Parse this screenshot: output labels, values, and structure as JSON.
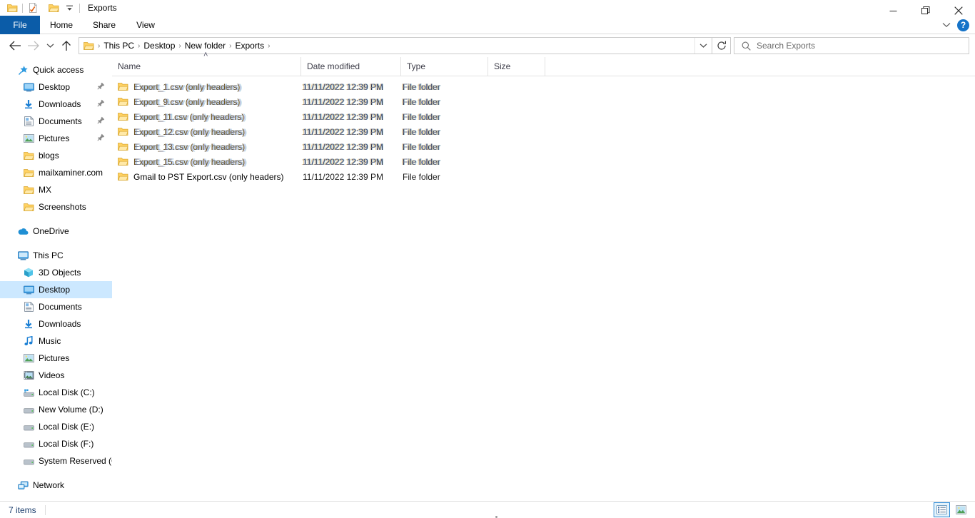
{
  "window": {
    "title": "Exports",
    "quick_access_toolbar": [
      {
        "name": "folder-icon",
        "label": "Properties folder"
      },
      {
        "name": "properties-icon",
        "label": "Properties"
      },
      {
        "name": "new-folder-icon",
        "label": "New folder"
      },
      {
        "name": "customize-qat-dropdown-icon",
        "label": "Customize Quick Access Toolbar"
      }
    ],
    "controls": {
      "minimize": "Minimize",
      "restore": "Restore Down",
      "close": "Close"
    }
  },
  "ribbon": {
    "tabs": [
      {
        "label": "File",
        "active": true
      },
      {
        "label": "Home",
        "active": false
      },
      {
        "label": "Share",
        "active": false
      },
      {
        "label": "View",
        "active": false
      }
    ],
    "collapse_label": "Minimize the Ribbon",
    "help_label": "?"
  },
  "addressbar": {
    "back": "Back",
    "forward": "Forward",
    "recent": "Recent locations",
    "up": "Up",
    "breadcrumbs": [
      "This PC",
      "Desktop",
      "New folder",
      "Exports"
    ],
    "separator": "›",
    "dropdown": "Previous locations",
    "refresh": "Refresh \"Exports\""
  },
  "search": {
    "placeholder": "Search Exports",
    "value": ""
  },
  "sidebar": {
    "groups": [
      {
        "header": {
          "label": "Quick access",
          "icon": "star-pin-icon"
        },
        "items": [
          {
            "label": "Desktop",
            "icon": "desktop-icon",
            "pinned": true
          },
          {
            "label": "Downloads",
            "icon": "downloads-icon",
            "pinned": true
          },
          {
            "label": "Documents",
            "icon": "documents-icon",
            "pinned": true
          },
          {
            "label": "Pictures",
            "icon": "pictures-icon",
            "pinned": true
          },
          {
            "label": "blogs",
            "icon": "folder-icon",
            "pinned": false
          },
          {
            "label": "mailxaminer.com",
            "icon": "folder-icon",
            "pinned": false
          },
          {
            "label": "MX",
            "icon": "folder-icon",
            "pinned": false
          },
          {
            "label": "Screenshots",
            "icon": "folder-icon",
            "pinned": false
          }
        ]
      },
      {
        "header": {
          "label": "OneDrive",
          "icon": "onedrive-icon"
        },
        "items": []
      },
      {
        "header": {
          "label": "This PC",
          "icon": "this-pc-icon"
        },
        "items": [
          {
            "label": "3D Objects",
            "icon": "3d-objects-icon",
            "selected": false
          },
          {
            "label": "Desktop",
            "icon": "desktop-icon",
            "selected": true
          },
          {
            "label": "Documents",
            "icon": "documents-icon",
            "selected": false
          },
          {
            "label": "Downloads",
            "icon": "downloads-icon",
            "selected": false
          },
          {
            "label": "Music",
            "icon": "music-icon",
            "selected": false
          },
          {
            "label": "Pictures",
            "icon": "pictures-icon",
            "selected": false
          },
          {
            "label": "Videos",
            "icon": "videos-icon",
            "selected": false
          },
          {
            "label": "Local Disk (C:)",
            "icon": "system-drive-icon",
            "selected": false
          },
          {
            "label": "New Volume (D:)",
            "icon": "drive-icon",
            "selected": false
          },
          {
            "label": "Local Disk (E:)",
            "icon": "drive-icon",
            "selected": false
          },
          {
            "label": "Local Disk (F:)",
            "icon": "drive-icon",
            "selected": false
          },
          {
            "label": "System Reserved (G",
            "icon": "drive-icon",
            "selected": false
          }
        ]
      },
      {
        "header": {
          "label": "Network",
          "icon": "network-icon"
        },
        "items": []
      }
    ]
  },
  "filelist": {
    "columns": [
      {
        "label": "Name",
        "sorted": "asc"
      },
      {
        "label": "Date modified",
        "sorted": ""
      },
      {
        "label": "Type",
        "sorted": ""
      },
      {
        "label": "Size",
        "sorted": ""
      }
    ],
    "sort_caret": "˄",
    "rows": [
      {
        "name": "Export_1.csv (only headers)",
        "name_clear": "Export_1",
        "date": "11/11/2022 12:39 PM",
        "type": "File folder",
        "size": "",
        "icon": "folder-icon",
        "ghost": true
      },
      {
        "name": "Export_9.csv (only headers)",
        "name_clear": "Export_9",
        "date": "11/11/2022 12:39 PM",
        "type": "File folder",
        "size": "",
        "icon": "folder-icon",
        "ghost": true
      },
      {
        "name": "Export_11.csv (only headers)",
        "name_clear": "Export_11",
        "date": "11/11/2022 12:39 PM",
        "type": "File folder",
        "size": "",
        "icon": "folder-icon",
        "ghost": true
      },
      {
        "name": "Export_12.csv (only headers)",
        "name_clear": "Export_12",
        "date": "11/11/2022 12:39 PM",
        "type": "File folder",
        "size": "",
        "icon": "folder-icon",
        "ghost": true
      },
      {
        "name": "Export_13.csv (only headers)",
        "name_clear": "Export_13",
        "date": "11/11/2022 12:39 PM",
        "type": "File folder",
        "size": "",
        "icon": "folder-icon",
        "ghost": true
      },
      {
        "name": "Export_15.csv (only headers)",
        "name_clear": "Export_15",
        "date": "11/11/2022 12:39 PM",
        "type": "File folder",
        "size": "",
        "icon": "folder-icon",
        "ghost": true
      },
      {
        "name": "Gmail to PST Export.csv (only headers)",
        "name_clear": "Gmail to PST Export.csv (only headers)",
        "date": "11/11/2022 12:39 PM",
        "type": "File folder",
        "size": "",
        "icon": "folder-icon",
        "ghost": false
      }
    ]
  },
  "statusbar": {
    "item_count": "7 items",
    "views": [
      {
        "name": "details-view",
        "label": "Details",
        "active": true
      },
      {
        "name": "large-icons-view",
        "label": "Large icons",
        "active": false
      }
    ]
  },
  "colors": {
    "accent": "#0b5ca8",
    "selection": "#cce8ff",
    "folder": "#ffd264",
    "status_text": "#1d3f6e",
    "help_blue": "#1573c8"
  }
}
